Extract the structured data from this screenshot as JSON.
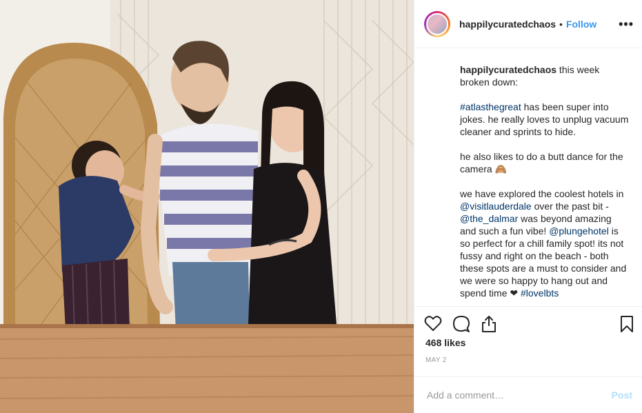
{
  "header": {
    "username": "happilycuratedchaos",
    "separator": "•",
    "follow_label": "Follow",
    "more_icon": "more-horizontal-icon",
    "more_label": "•••"
  },
  "caption": {
    "username": "happilycuratedchaos",
    "line1_text": " this week broken down:",
    "p2_tag": "#atlasthegreat",
    "p2_text": " has been super into jokes. he really loves to unplug vacuum cleaner and sprints to hide.",
    "p3_text": "he also likes to do a butt dance for the camera 🙈",
    "p4_a": "we have explored the coolest hotels in ",
    "p4_mention1": "@visitlauderdale",
    "p4_b": " over the past bit - ",
    "p4_mention2": "@the_dalmar",
    "p4_c": " was beyond amazing and such a fun vibe! ",
    "p4_mention3": "@plungehotel",
    "p4_d": " is so perfect for a chill family spot! its not fussy and right on the beach - both these spots are a must to consider and we were so happy to hang out and spend time ❤ ",
    "p4_tag": "#lovelbts"
  },
  "actions": {
    "like_icon": "heart-icon",
    "comment_icon": "comment-icon",
    "share_icon": "share-icon",
    "save_icon": "bookmark-icon"
  },
  "likes_text": "468 likes",
  "date_text": "MAY 2",
  "comment": {
    "placeholder": "Add a comment…",
    "post_label": "Post"
  },
  "colors": {
    "link": "#003569",
    "follow": "#3897f0",
    "post_disabled": "#b2dffc",
    "border": "#efefef"
  }
}
